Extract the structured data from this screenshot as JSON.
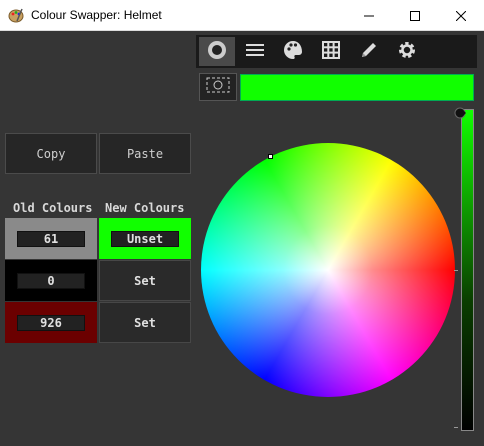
{
  "window": {
    "title": "Colour Swapper: Helmet",
    "icon": "palette-app-icon"
  },
  "toolbar": {
    "buttons": [
      {
        "name": "swap-icon",
        "active": true
      },
      {
        "name": "list-icon",
        "active": false
      },
      {
        "name": "palette-icon",
        "active": false
      },
      {
        "name": "grid-icon",
        "active": false
      },
      {
        "name": "pencil-icon",
        "active": false
      },
      {
        "name": "settings-icon",
        "active": false
      }
    ]
  },
  "preview": {
    "color": "#11ff00"
  },
  "actions": {
    "copy": "Copy",
    "paste": "Paste"
  },
  "headers": {
    "old": "Old Colours",
    "new": "New Colours"
  },
  "rows": [
    {
      "old_value": "61",
      "old_color": "#8a8a8a",
      "new_label": "Unset",
      "new_color": "#11ff00"
    },
    {
      "old_value": "0",
      "old_color": "#000000",
      "new_label": "Set",
      "new_color": "#2a2a2a"
    },
    {
      "old_value": "926",
      "old_color": "#6b0000",
      "new_label": "Set",
      "new_color": "#2a2a2a"
    }
  ],
  "brightness": {
    "level": 1.0
  }
}
